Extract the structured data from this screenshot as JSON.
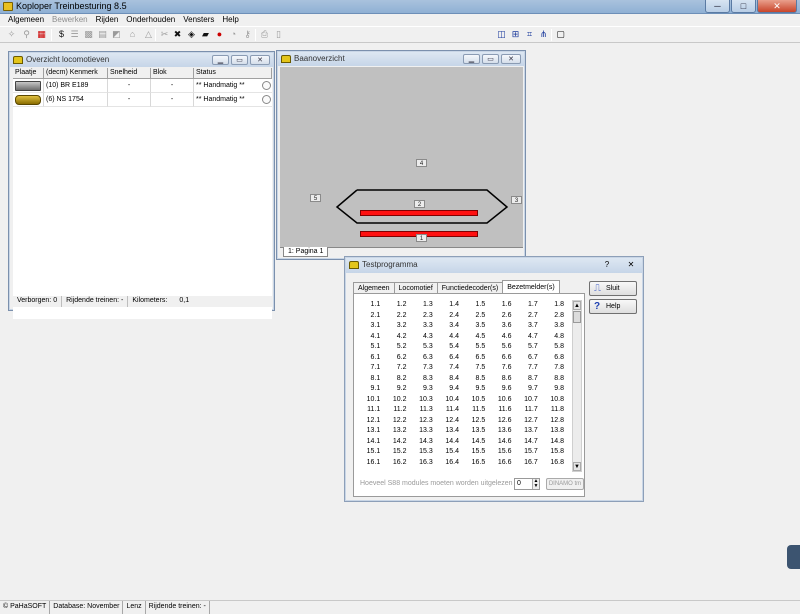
{
  "app": {
    "title": "Koploper Treinbesturing 8.5",
    "window_buttons": {
      "minimize": "─",
      "maximize": "□",
      "close": "✕"
    }
  },
  "menu": [
    {
      "label": "Algemeen",
      "disabled": false
    },
    {
      "label": "Bewerken",
      "disabled": true
    },
    {
      "label": "Rijden",
      "disabled": false
    },
    {
      "label": "Onderhouden",
      "disabled": false
    },
    {
      "label": "Vensters",
      "disabled": false
    },
    {
      "label": "Help",
      "disabled": false
    }
  ],
  "toolbar": {
    "icons": [
      "lightbulb-icon",
      "search-icon",
      "table-icon",
      "dollar-icon",
      "list-icon",
      "grid-icon",
      "doc-icon",
      "fill-icon",
      "lock-icon",
      "cross-icon",
      "signal-icon",
      "horn-icon",
      "locomotive-icon",
      "record-icon",
      "clock-icon",
      "key-icon",
      "camera-icon",
      "printer-icon",
      "page-icon",
      "window-icon",
      "cascade-icon",
      "tile-icon",
      "network-icon",
      "blank-window-icon"
    ]
  },
  "loco_window": {
    "title": "Overzicht locomotieven",
    "columns": [
      "Plaatje",
      "(decm) Kenmerk",
      "Snelheid",
      "Blok",
      "Status"
    ],
    "rows": [
      {
        "kenmerk": "(10) BR E189",
        "snelheid": "-",
        "blok": "-",
        "status": "** Handmatig **"
      },
      {
        "kenmerk": "(6) NS 1754",
        "snelheid": "-",
        "blok": "-",
        "status": "** Handmatig **"
      }
    ],
    "status": {
      "verborgen_label": "Verborgen:",
      "verborgen_value": "0",
      "rijdende_label": "Rijdende treinen:",
      "rijdende_value": "-",
      "km_label": "Kilometers:",
      "km_value": "0,1"
    }
  },
  "track_window": {
    "title": "Baanoverzicht",
    "blocks": [
      "1",
      "2",
      "3",
      "4",
      "5"
    ],
    "page_tab": "1: Pagina 1"
  },
  "test_window": {
    "title": "Testprogramma",
    "help_glyph": "?",
    "close_glyph": "✕",
    "tabs": [
      {
        "label": "Algemeen",
        "active": false
      },
      {
        "label": "Locomotief",
        "active": false
      },
      {
        "label": "Functiedecoder(s)",
        "active": false
      },
      {
        "label": "Bezetmelder(s)",
        "active": true
      }
    ],
    "cells": [
      [
        "1.1",
        "1.2",
        "1.3",
        "1.4",
        "1.5",
        "1.6",
        "1.7",
        "1.8"
      ],
      [
        "2.1",
        "2.2",
        "2.3",
        "2.4",
        "2.5",
        "2.6",
        "2.7",
        "2.8"
      ],
      [
        "3.1",
        "3.2",
        "3.3",
        "3.4",
        "3.5",
        "3.6",
        "3.7",
        "3.8"
      ],
      [
        "4.1",
        "4.2",
        "4.3",
        "4.4",
        "4.5",
        "4.6",
        "4.7",
        "4.8"
      ],
      [
        "5.1",
        "5.2",
        "5.3",
        "5.4",
        "5.5",
        "5.6",
        "5.7",
        "5.8"
      ],
      [
        "6.1",
        "6.2",
        "6.3",
        "6.4",
        "6.5",
        "6.6",
        "6.7",
        "6.8"
      ],
      [
        "7.1",
        "7.2",
        "7.3",
        "7.4",
        "7.5",
        "7.6",
        "7.7",
        "7.8"
      ],
      [
        "8.1",
        "8.2",
        "8.3",
        "8.4",
        "8.5",
        "8.6",
        "8.7",
        "8.8"
      ],
      [
        "9.1",
        "9.2",
        "9.3",
        "9.4",
        "9.5",
        "9.6",
        "9.7",
        "9.8"
      ],
      [
        "10.1",
        "10.2",
        "10.3",
        "10.4",
        "10.5",
        "10.6",
        "10.7",
        "10.8"
      ],
      [
        "11.1",
        "11.2",
        "11.3",
        "11.4",
        "11.5",
        "11.6",
        "11.7",
        "11.8"
      ],
      [
        "12.1",
        "12.2",
        "12.3",
        "12.4",
        "12.5",
        "12.6",
        "12.7",
        "12.8"
      ],
      [
        "13.1",
        "13.2",
        "13.3",
        "13.4",
        "13.5",
        "13.6",
        "13.7",
        "13.8"
      ],
      [
        "14.1",
        "14.2",
        "14.3",
        "14.4",
        "14.5",
        "14.6",
        "14.7",
        "14.8"
      ],
      [
        "15.1",
        "15.2",
        "15.3",
        "15.4",
        "15.5",
        "15.6",
        "15.7",
        "15.8"
      ],
      [
        "16.1",
        "16.2",
        "16.3",
        "16.4",
        "16.5",
        "16.6",
        "16.7",
        "16.8"
      ]
    ],
    "sbb_label": "Hoeveel S88 modules moeten worden uitgelezen",
    "sbb_value": "0",
    "dinamo_label": "DINAMO tm",
    "sluit_label": "Sluit",
    "help_label": "Help"
  },
  "app_status": [
    "© PaHaSOFT",
    "Database: November",
    "Lenz",
    "Rijdende treinen: -"
  ],
  "colors": {
    "occupied_track": "#ff1010",
    "track_canvas": "#c0c0c0",
    "title_gradient": "#c6d5e8"
  }
}
